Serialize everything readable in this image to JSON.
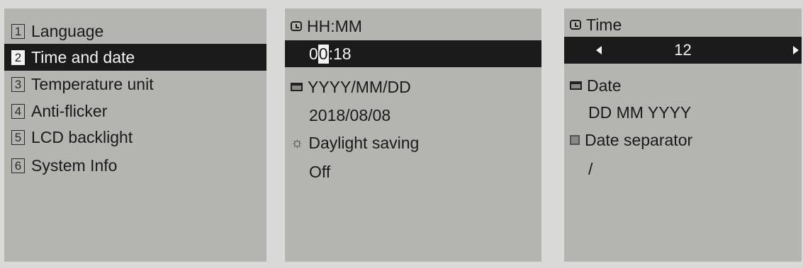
{
  "menu": {
    "items": [
      {
        "num": "1",
        "label": "Language"
      },
      {
        "num": "2",
        "label": "Time and date"
      },
      {
        "num": "3",
        "label": "Temperature unit"
      },
      {
        "num": "4",
        "label": "Anti-flicker"
      },
      {
        "num": "5",
        "label": "LCD backlight"
      },
      {
        "num": "6",
        "label": "System Info"
      }
    ],
    "selected": "Time and date"
  },
  "time_date": {
    "time_format_label": "HH:MM",
    "time_value_before": "0",
    "time_value_cursor": "0",
    "time_value_after": ":18",
    "date_format_label": "YYYY/MM/DD",
    "date_value": "2018/08/08",
    "daylight_label": "Daylight saving",
    "daylight_value": "Off"
  },
  "format": {
    "time_label": "Time",
    "time_value": "12",
    "date_label": "Date",
    "date_value": "DD MM YYYY",
    "separator_label": "Date separator",
    "separator_value": "/"
  },
  "icons": {
    "time": "clock-icon",
    "date": "calendar-icon",
    "daylight": "sun-icon",
    "separator": "separator-icon",
    "left": "arrow-left-icon",
    "right": "arrow-right-icon"
  },
  "colors": {
    "screen_bg": "#b4b5b1",
    "highlight_bg": "#1b1b1b",
    "highlight_text": "#f2f2f2",
    "text": "#1a1a1a"
  }
}
